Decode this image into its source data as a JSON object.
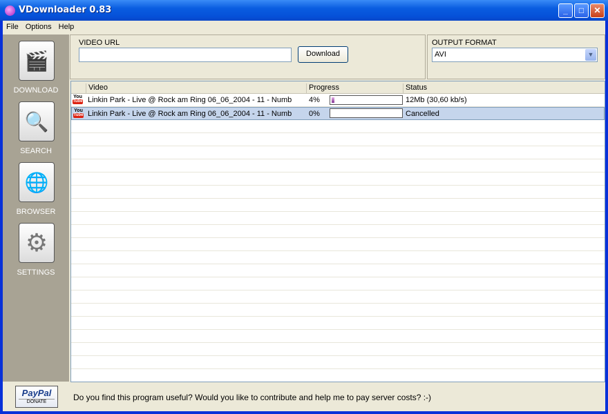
{
  "window": {
    "title": "VDownloader 0.83",
    "minimize": "_",
    "maximize": "□",
    "close": "✕"
  },
  "menu": [
    "File",
    "Options",
    "Help"
  ],
  "sidebar": [
    {
      "label": "DOWNLOAD",
      "icon": "clapboard-download-icon",
      "glyph": "🎬"
    },
    {
      "label": "SEARCH",
      "icon": "magnifier-icon",
      "glyph": "🔍"
    },
    {
      "label": "BROWSER",
      "icon": "globe-icon",
      "glyph": "🌐"
    },
    {
      "label": "SETTINGS",
      "icon": "gear-icon",
      "glyph": "⚙"
    }
  ],
  "url": {
    "label": "VIDEO URL",
    "value": "",
    "button": "Download"
  },
  "format": {
    "label": "OUTPUT FORMAT",
    "value": "AVI"
  },
  "list": {
    "headers": [
      "Video",
      "Progress",
      "Status"
    ],
    "rows": [
      {
        "source": "You Tube",
        "video": "Linkin Park - Live @ Rock am Ring 06_06_2004 - 11 - Numb",
        "progress_text": "4%",
        "progress": 4,
        "status": "12Mb (30,60 kb/s)"
      },
      {
        "source": "You Tube",
        "video": "Linkin Park - Live @ Rock am Ring 06_06_2004 - 11 - Numb",
        "progress_text": "0%",
        "progress": 0,
        "status": "Cancelled"
      }
    ]
  },
  "footer": {
    "paypal": "PayPal",
    "donate": "DONATE",
    "message": "Do you find this program useful? Would you like to contribute and help me to pay server costs? :-)"
  }
}
